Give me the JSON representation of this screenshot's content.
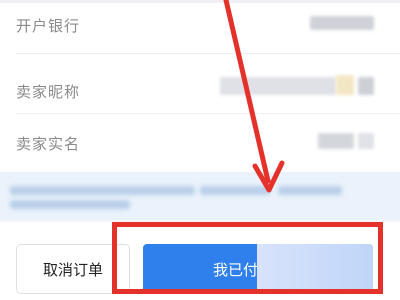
{
  "info_rows": [
    {
      "label": "开户银行"
    },
    {
      "label": "卖家昵称"
    },
    {
      "label": "卖家实名"
    }
  ],
  "actions": {
    "cancel_label": "取消订单",
    "paid_label": "我已付"
  },
  "colors": {
    "primary": "#2f80ed",
    "highlight": "#e4322b",
    "notice_bg": "#eaf2fb"
  },
  "icons": {
    "annotation": "red-arrow-icon"
  }
}
